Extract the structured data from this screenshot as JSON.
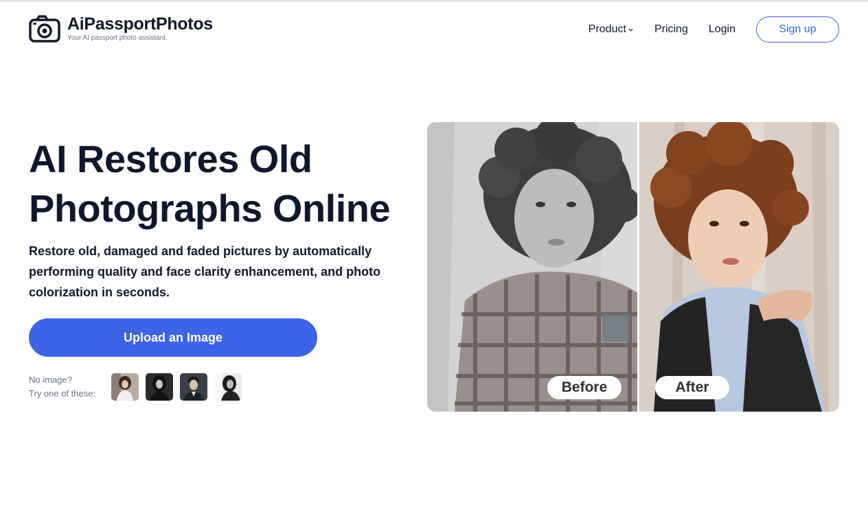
{
  "brand": {
    "name": "AiPassportPhotos",
    "tagline": "Your AI passport photo assistant."
  },
  "nav": {
    "product": "Product",
    "pricing": "Pricing",
    "login": "Login",
    "signup": "Sign up"
  },
  "hero": {
    "title_line1": "AI Restores Old",
    "title_line2": "Photographs Online",
    "description": "Restore old, damaged and faded pictures by automatically performing quality and face clarity enhancement, and photo colorization in seconds.",
    "upload_label": "Upload an Image",
    "no_image": "No image?",
    "try_these": "Try one of these:"
  },
  "samples": [
    {
      "icon": "sample-woman-light"
    },
    {
      "icon": "sample-woman-dark"
    },
    {
      "icon": "sample-man-dark"
    },
    {
      "icon": "sample-woman-bw"
    }
  ],
  "comparison": {
    "before_label": "Before",
    "after_label": "After"
  },
  "colors": {
    "accent": "#3d63e6",
    "heading": "#0f172a",
    "muted": "#6b7280"
  }
}
